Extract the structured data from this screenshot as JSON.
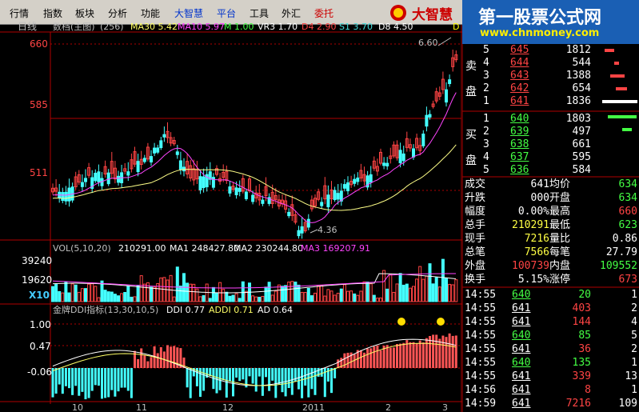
{
  "menu": {
    "items": [
      {
        "label": "行情",
        "style": "normal"
      },
      {
        "label": "指数",
        "style": "normal"
      },
      {
        "label": "板块",
        "style": "normal"
      },
      {
        "label": "分析",
        "style": "normal"
      },
      {
        "label": "功能",
        "style": "normal"
      },
      {
        "label": "大智慧",
        "style": "blue"
      },
      {
        "label": "平台",
        "style": "blue"
      },
      {
        "label": "工具",
        "style": "normal"
      },
      {
        "label": "外汇",
        "style": "normal"
      },
      {
        "label": "委托",
        "style": "red"
      }
    ],
    "brand": "大智慧"
  },
  "watermark": {
    "title": "第一股票公式网",
    "url": "www.chnmoney.com"
  },
  "kline": {
    "period_label": "日线",
    "info_segments": [
      {
        "text": "数档(主图)",
        "color": "#c0c0c0"
      },
      {
        "text": "(256)",
        "color": "#c0c0c0"
      },
      {
        "text": "MA30 5.42",
        "color": "#ffff66"
      },
      {
        "text": "MA10 5.97",
        "color": "#ff44ff"
      },
      {
        "text": "M 1.00",
        "color": "#44ff44"
      },
      {
        "text": "VR3 1.70",
        "color": "#ffffff"
      },
      {
        "text": "D4 2.90",
        "color": "#ff4444"
      },
      {
        "text": "S1 3.70",
        "color": "#44dddd"
      },
      {
        "text": "D8 4.50",
        "color": "#ffffff"
      },
      {
        "text": "D",
        "color": "#ffff00"
      }
    ],
    "y_labels": [
      "660",
      "585",
      "511"
    ],
    "high_label": "6.60",
    "low_label": "4.36"
  },
  "volume": {
    "info_segments": [
      {
        "text": "VOL(5,10,20)",
        "color": "#c0c0c0"
      },
      {
        "text": "210291.00",
        "color": "#ffffff"
      },
      {
        "text": "MA1 248427.80",
        "color": "#ffffff"
      },
      {
        "text": "MA2 230244.80",
        "color": "#ffffff"
      },
      {
        "text": "MA3 169207.91",
        "color": "#ff44ff"
      }
    ],
    "y_labels": [
      "39240",
      "19620"
    ],
    "multiplier": "X10"
  },
  "ddi": {
    "info_segments": [
      {
        "text": "金牌DDI指标(13,30,10,5)",
        "color": "#c0c0c0"
      },
      {
        "text": "DDI 0.77",
        "color": "#ffffff"
      },
      {
        "text": "ADDI 0.71",
        "color": "#ffff66"
      },
      {
        "text": "AD 0.64",
        "color": "#ffffff"
      }
    ],
    "y_labels": [
      "1.00",
      "0.47",
      "-0.06"
    ]
  },
  "x_axis": [
    "10",
    "11",
    "12",
    "2011",
    "2",
    "3"
  ],
  "quote": {
    "asks": [
      {
        "side": "",
        "level": "5",
        "price": "645",
        "vol": "1812"
      },
      {
        "side": "卖",
        "level": "4",
        "price": "644",
        "vol": "544"
      },
      {
        "side": "",
        "level": "3",
        "price": "643",
        "vol": "1388"
      },
      {
        "side": "盘",
        "level": "2",
        "price": "642",
        "vol": "654"
      },
      {
        "side": "",
        "level": "1",
        "price": "641",
        "vol": "1836"
      }
    ],
    "bids": [
      {
        "side": "",
        "level": "1",
        "price": "640",
        "vol": "1803"
      },
      {
        "side": "买",
        "level": "2",
        "price": "639",
        "vol": "497"
      },
      {
        "side": "",
        "level": "3",
        "price": "638",
        "vol": "661"
      },
      {
        "side": "盘",
        "level": "4",
        "price": "637",
        "vol": "595"
      },
      {
        "side": "",
        "level": "5",
        "price": "636",
        "vol": "584"
      }
    ],
    "stats": [
      {
        "l1": "成交",
        "v1": "641",
        "l2": "均价",
        "v2": "634",
        "c1": "#ffffff",
        "c2": "#44ff44"
      },
      {
        "l1": "升跌",
        "v1": "000",
        "l2": "开盘",
        "v2": "634",
        "c1": "#ffffff",
        "c2": "#44ff44"
      },
      {
        "l1": "幅度",
        "v1": "0.00%",
        "l2": "最高",
        "v2": "660",
        "c1": "#ffffff",
        "c2": "#ff4444"
      },
      {
        "l1": "总手",
        "v1": "210291",
        "l2": "最低",
        "v2": "623",
        "c1": "#ffff44",
        "c2": "#44ff44"
      },
      {
        "l1": "现手",
        "v1": "7216",
        "l2": "量比",
        "v2": "0.86",
        "c1": "#ffff44",
        "c2": "#ffffff"
      },
      {
        "l1": "总笔",
        "v1": "7566",
        "l2": "每笔",
        "v2": "27.79",
        "c1": "#ffff44",
        "c2": "#ffffff"
      },
      {
        "l1": "外盘",
        "v1": "100739",
        "l2": "内盘",
        "v2": "109552",
        "c1": "#ff4444",
        "c2": "#44ff44"
      },
      {
        "l1": "换手",
        "v1": "5.15%",
        "l2": "涨停",
        "v2": "673",
        "c1": "#ffffff",
        "c2": "#ff4444"
      }
    ],
    "ticks": [
      {
        "time": "14:55",
        "price": "640",
        "vol": "20",
        "n": "1",
        "pc": "#44ff44",
        "vc": "#44ff44"
      },
      {
        "time": "14:55",
        "price": "641",
        "vol": "403",
        "n": "2",
        "pc": "#ffffff",
        "vc": "#ff4444"
      },
      {
        "time": "14:55",
        "price": "641",
        "vol": "144",
        "n": "4",
        "pc": "#ffffff",
        "vc": "#ff4444"
      },
      {
        "time": "14:55",
        "price": "640",
        "vol": "85",
        "n": "5",
        "pc": "#44ff44",
        "vc": "#44ff44"
      },
      {
        "time": "14:55",
        "price": "641",
        "vol": "36",
        "n": "2",
        "pc": "#ffffff",
        "vc": "#ff4444"
      },
      {
        "time": "14:55",
        "price": "640",
        "vol": "135",
        "n": "1",
        "pc": "#44ff44",
        "vc": "#44ff44"
      },
      {
        "time": "14:55",
        "price": "641",
        "vol": "339",
        "n": "13",
        "pc": "#ffffff",
        "vc": "#ff4444"
      },
      {
        "time": "14:56",
        "price": "641",
        "vol": "8",
        "n": "1",
        "pc": "#ffffff",
        "vc": "#ff4444"
      },
      {
        "time": "14:59",
        "price": "641",
        "vol": "7216",
        "n": "109",
        "pc": "#ffffff",
        "vc": "#ff4444"
      }
    ]
  }
}
